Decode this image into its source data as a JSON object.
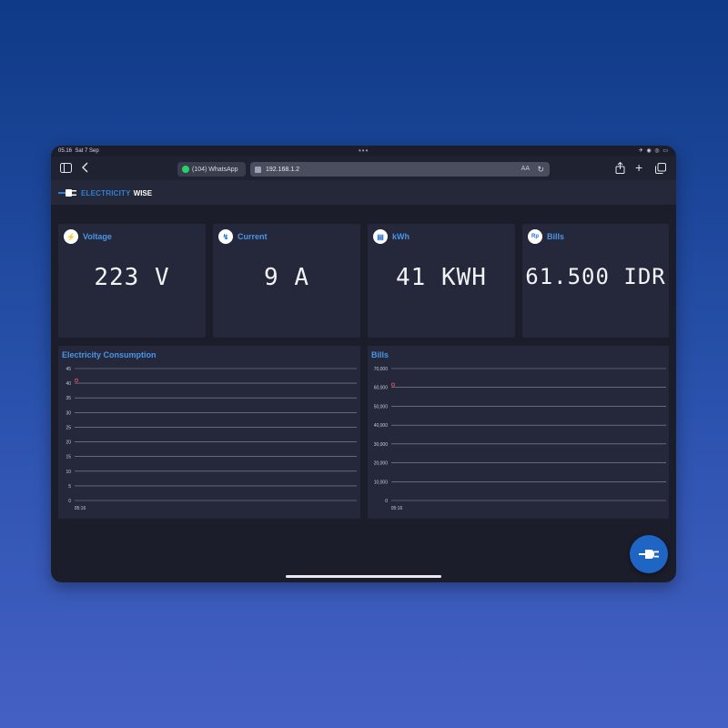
{
  "status": {
    "time": "05.16",
    "date": "Sat 7 Sep",
    "right": "✈ ◉ ◎ ▭"
  },
  "browser": {
    "tab_label": "(104) WhatsApp",
    "url": "192.168.1.2",
    "aa": "AA"
  },
  "app": {
    "brand_left": "ELECTRICITY",
    "brand_right": "WISE"
  },
  "cards": [
    {
      "title": "Voltage",
      "icon": "bolt-icon",
      "glyph": "⚡",
      "value": "223 V"
    },
    {
      "title": "Current",
      "icon": "current-icon",
      "glyph": "↯",
      "value": "9 A"
    },
    {
      "title": "kWh",
      "icon": "meter-icon",
      "glyph": "▤",
      "value": "41 KWH"
    },
    {
      "title": "Bills",
      "icon": "rupiah-icon",
      "glyph": "Rp",
      "value": "61.500 IDR"
    }
  ],
  "charts": {
    "consumption": {
      "title": "Electricity Consumption"
    },
    "bills": {
      "title": "Bills"
    }
  },
  "chart_data": [
    {
      "type": "line",
      "title": "Electricity Consumption",
      "x": [
        "05:16"
      ],
      "series": [
        {
          "values": [
            41
          ]
        }
      ],
      "ylim": [
        0,
        45
      ],
      "yticks": [
        "0",
        "5",
        "10",
        "15",
        "20",
        "25",
        "30",
        "35",
        "40",
        "45"
      ],
      "grid": true,
      "color": "#e05060"
    },
    {
      "type": "line",
      "title": "Bills",
      "x": [
        "05:16"
      ],
      "series": [
        {
          "values": [
            61500
          ]
        }
      ],
      "ylim": [
        0,
        70000
      ],
      "yticks": [
        "0",
        "10,000",
        "20,000",
        "30,000",
        "40,000",
        "50,000",
        "60,000",
        "70,000"
      ],
      "grid": true,
      "color": "#e05060"
    }
  ],
  "colors": {
    "accent": "#4a95e8",
    "card_bg": "#25283a",
    "page_bg": "#1b1d2b",
    "fab": "#1f65c4"
  }
}
